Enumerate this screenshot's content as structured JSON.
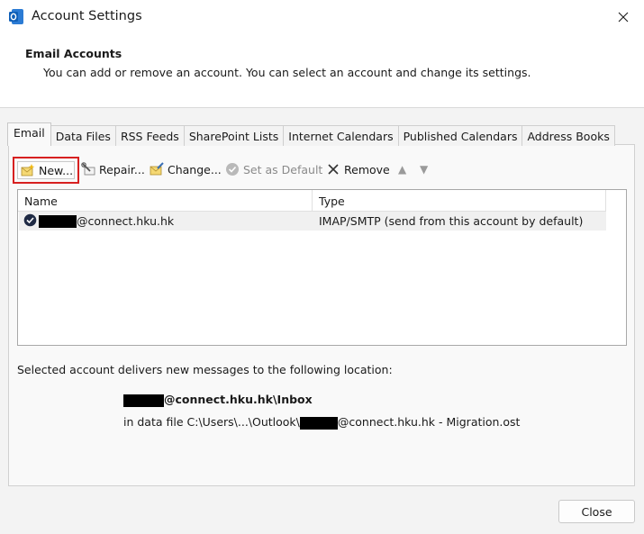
{
  "window": {
    "title": "Account Settings"
  },
  "header": {
    "title": "Email Accounts",
    "description": "You can add or remove an account. You can select an account and change its settings."
  },
  "tabs": [
    {
      "label": "Email",
      "active": true
    },
    {
      "label": "Data Files"
    },
    {
      "label": "RSS Feeds"
    },
    {
      "label": "SharePoint Lists"
    },
    {
      "label": "Internet Calendars"
    },
    {
      "label": "Published Calendars"
    },
    {
      "label": "Address Books"
    }
  ],
  "toolbar": {
    "new_label": "New...",
    "repair_label": "Repair...",
    "change_label": "Change...",
    "set_default_label": "Set as Default",
    "remove_label": "Remove"
  },
  "table": {
    "columns": [
      "Name",
      "Type"
    ],
    "rows": [
      {
        "name_suffix": "@connect.hku.hk",
        "type": "IMAP/SMTP (send from this account by default)"
      }
    ]
  },
  "location": {
    "label": "Selected account delivers new messages to the following location:",
    "inbox_suffix": "@connect.hku.hk\\Inbox",
    "file_prefix": "in data file C:\\Users\\...\\Outlook\\",
    "file_suffix": "@connect.hku.hk - Migration.ost"
  },
  "footer": {
    "close_label": "Close"
  },
  "colors": {
    "highlight_border": "#d72020",
    "accent": "#0f6cbd"
  },
  "icons": [
    "outlook-icon",
    "close-icon",
    "new-account-icon",
    "repair-icon",
    "change-icon",
    "set-default-icon",
    "remove-icon",
    "move-up-icon",
    "move-down-icon",
    "default-account-check-icon"
  ]
}
